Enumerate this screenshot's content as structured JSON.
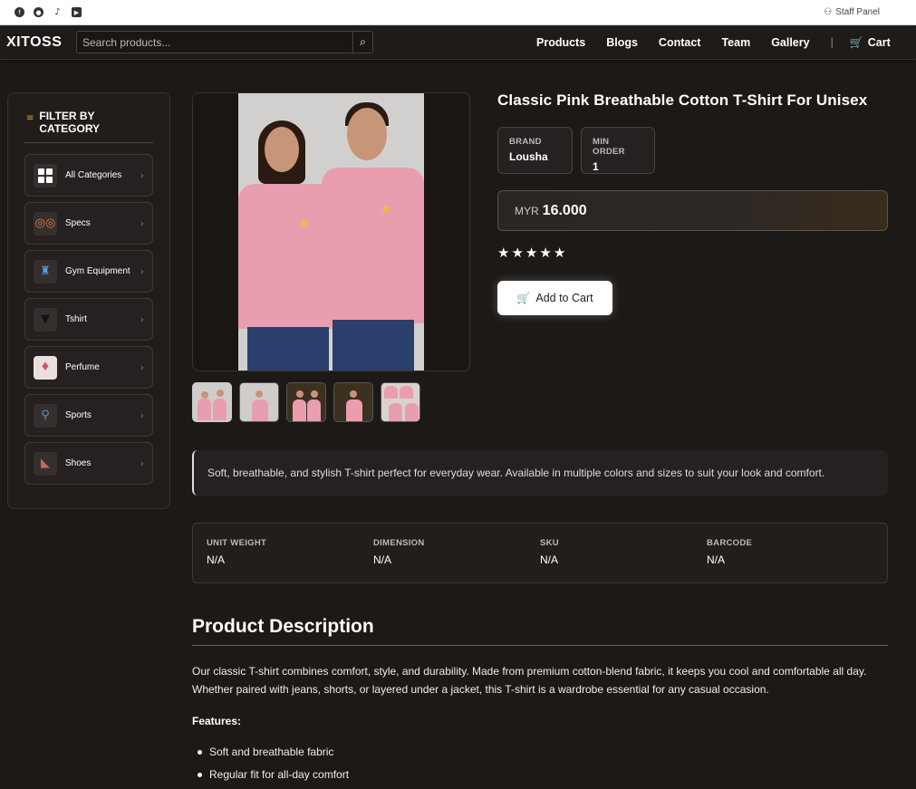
{
  "topbar": {
    "social_icons": [
      "facebook-icon",
      "github-icon",
      "tiktok-icon",
      "youtube-icon"
    ],
    "staff_label": "Staff Panel"
  },
  "navbar": {
    "logo": "XITOSS",
    "search_placeholder": "Search products...",
    "menu": [
      "Products",
      "Blogs",
      "Contact",
      "Team",
      "Gallery"
    ],
    "cart_label": "Cart"
  },
  "sidebar": {
    "heading": "FILTER BY CATEGORY",
    "categories": [
      "All Categories",
      "Specs",
      "Gym Equipment",
      "Tshirt",
      "Perfume",
      "Sports",
      "Shoes"
    ]
  },
  "product": {
    "title": "Classic Pink Breathable Cotton T-Shirt For Unisex",
    "brand_key": "BRAND",
    "brand_value": "Lousha",
    "min_order_key": "MIN ORDER",
    "min_order_value": "1",
    "currency": "MYR",
    "price": "16.000",
    "rating": 5,
    "add_to_cart": "Add to Cart",
    "short_description": "Soft, breathable, and stylish T-shirt perfect for everyday wear. Available in multiple colors and sizes to suit your look and comfort.",
    "attributes": [
      {
        "key": "UNIT WEIGHT",
        "value": "N/A"
      },
      {
        "key": "DIMENSION",
        "value": "N/A"
      },
      {
        "key": "SKU",
        "value": "N/A"
      },
      {
        "key": "BARCODE",
        "value": "N/A"
      }
    ]
  },
  "description": {
    "heading": "Product Description",
    "body": "Our classic T-shirt combines comfort, style, and durability. Made from premium cotton-blend fabric, it keeps you cool and comfortable all day. Whether paired with jeans, shorts, or layered under a jacket, this T-shirt is a wardrobe essential for any casual occasion.",
    "features_heading": "Features:",
    "features": [
      "Soft and breathable fabric",
      "Regular fit for all-day comfort"
    ]
  },
  "colors": {
    "background": "#1d1917",
    "accent": "#e89a3c",
    "shirt": "#e99eb0"
  }
}
